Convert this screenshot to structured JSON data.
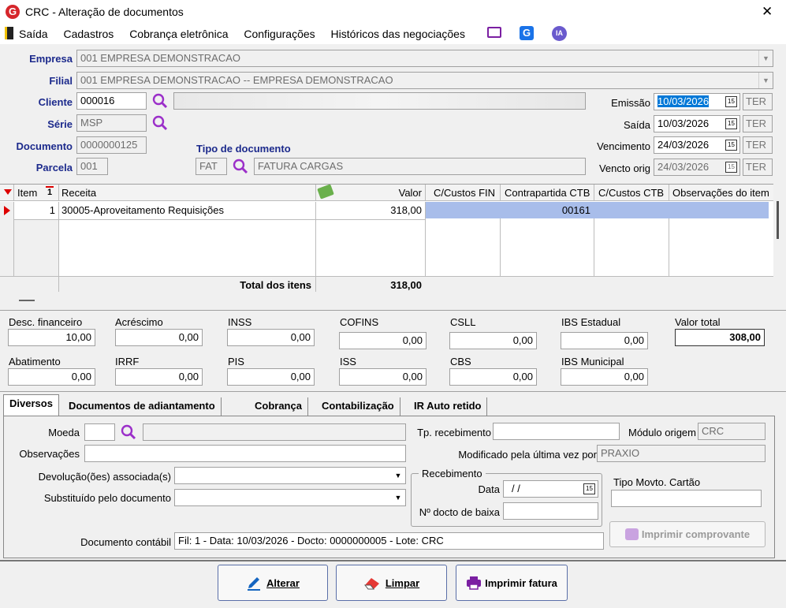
{
  "window": {
    "title": "CRC - Alteração de documentos",
    "close_glyph": "✕"
  },
  "menu": [
    "Saída",
    "Cadastros",
    "Cobrança eletrônica",
    "Configurações",
    "Históricos das negociações"
  ],
  "menu_icons": [
    "monitor-icon",
    "g-app-icon",
    "ia-icon"
  ],
  "header": {
    "empresa_label": "Empresa",
    "empresa_value": "001 EMPRESA DEMONSTRACAO",
    "filial_label": "Filial",
    "filial_value": "001 EMPRESA DEMONSTRACAO -- EMPRESA DEMONSTRACAO",
    "cliente_label": "Cliente",
    "cliente_value": "000016",
    "serie_label": "Série",
    "serie_value": "MSP",
    "documento_label": "Documento",
    "documento_value": "0000000125",
    "parcela_label": "Parcela",
    "parcela_value": "001",
    "tipo_doc_label": "Tipo de documento",
    "tipo_doc_code": "FAT",
    "tipo_doc_desc": "FATURA CARGAS",
    "emissao_label": "Emissão",
    "emissao_value": "10/03/2026",
    "emissao_dow": "TER",
    "saida_label": "Saída",
    "saida_value": "10/03/2026",
    "saida_dow": "TER",
    "vencimento_label": "Vencimento",
    "vencimento_value": "24/03/2026",
    "vencimento_dow": "TER",
    "vencto_orig_label": "Vencto orig",
    "vencto_orig_value": "24/03/2026",
    "vencto_orig_dow": "TER",
    "cal_glyph": "15"
  },
  "grid": {
    "columns": [
      "Item",
      "Receita",
      "Valor",
      "C/Custos FIN",
      "Contrapartida CTB",
      "C/Custos CTB",
      "Observações do item"
    ],
    "rows": [
      {
        "item": "1",
        "receita": "30005-Aproveitamento Requisições",
        "valor": "318,00",
        "cc_fin": "",
        "contrapartida": "00161",
        "cc_ctb": "",
        "obs": ""
      }
    ],
    "total_label": "Total dos itens",
    "total_value": "318,00",
    "sort_glyph": "1"
  },
  "totals": {
    "desc_fin_label": "Desc. financeiro",
    "desc_fin": "10,00",
    "acrescimo_label": "Acréscimo",
    "acrescimo": "0,00",
    "inss_label": "INSS",
    "inss": "0,00",
    "cofins_label": "COFINS",
    "cofins": "0,00",
    "csll_label": "CSLL",
    "csll": "0,00",
    "ibs_est_label": "IBS Estadual",
    "ibs_est": "0,00",
    "valor_total_label": "Valor total",
    "valor_total": "308,00",
    "abatimento_label": "Abatimento",
    "abatimento": "0,00",
    "irrf_label": "IRRF",
    "irrf": "0,00",
    "pis_label": "PIS",
    "pis": "0,00",
    "iss_label": "ISS",
    "iss": "0,00",
    "cbs_label": "CBS",
    "cbs": "0,00",
    "ibs_mun_label": "IBS Municipal",
    "ibs_mun": "0,00"
  },
  "tabs": [
    "Diversos",
    "Documentos de adiantamento",
    "Cobrança",
    "Contabilização",
    "IR Auto retido"
  ],
  "diversos": {
    "moeda_label": "Moeda",
    "moeda_value": "",
    "obs_label": "Observações",
    "obs_value": "",
    "devolucao_label": "Devolução(ões) associada(s)",
    "substituido_label": "Substituído pelo documento",
    "tp_receb_label": "Tp. recebimento",
    "tp_receb_value": "",
    "modulo_label": "Módulo origem",
    "modulo_value": "CRC",
    "modificado_label": "Modificado pela última vez por",
    "modificado_value": "PRAXIO",
    "recebimento_legend": "Recebimento",
    "data_label": "Data",
    "data_value": "/ /",
    "docto_baixa_label": "Nº docto de baixa",
    "docto_baixa_value": "",
    "tipo_cartao_label": "Tipo Movto. Cartão",
    "tipo_cartao_value": "",
    "imprimir_comprovante": "Imprimir comprovante",
    "doc_contabil_label": "Documento contábil",
    "doc_contabil_value": "Fil: 1 - Data: 10/03/2026 - Docto: 0000000005 - Lote: CRC"
  },
  "buttons": {
    "alterar": "Alterar",
    "limpar": "Limpar",
    "imprimir_fatura": "Imprimir fatura"
  }
}
